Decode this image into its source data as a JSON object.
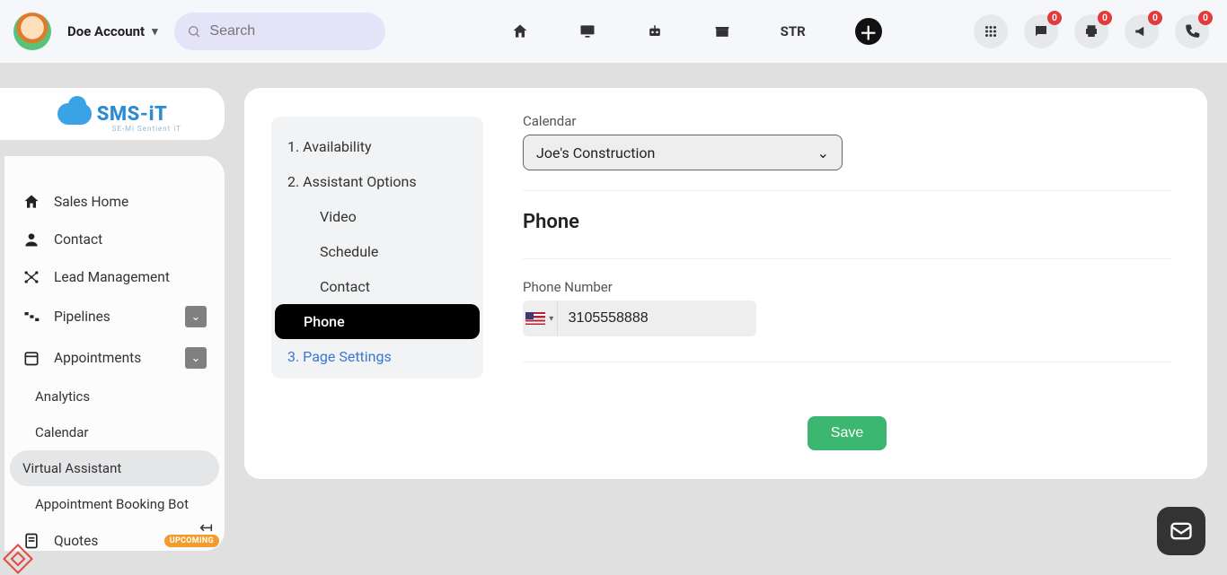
{
  "header": {
    "account_label": "Doe Account",
    "search_placeholder": "Search",
    "str_label": "STR",
    "badge_value": "0"
  },
  "logo": {
    "brand": "SMS-iT",
    "tagline": "SE-Mi Sentient iT"
  },
  "sidebar": {
    "items": {
      "sales_home": "Sales Home",
      "contact": "Contact",
      "lead_management": "Lead Management",
      "pipelines": "Pipelines",
      "appointments": "Appointments",
      "analytics": "Analytics",
      "calendar": "Calendar",
      "virtual_assistant": "Virtual Assistant",
      "appointment_booking_bot": "Appointment Booking Bot",
      "quotes": "Quotes"
    },
    "upcoming_badge": "UPCOMING"
  },
  "wizard": {
    "step1": "1. Availability",
    "step2": "2. Assistant Options",
    "sub_video": "Video",
    "sub_schedule": "Schedule",
    "sub_contact": "Contact",
    "sub_phone": "Phone",
    "step3": "3. Page Settings"
  },
  "form": {
    "calendar_label": "Calendar",
    "calendar_value": "Joe's Construction",
    "phone_section": "Phone",
    "phone_label": "Phone Number",
    "phone_value": "3105558888",
    "save_btn": "Save"
  }
}
